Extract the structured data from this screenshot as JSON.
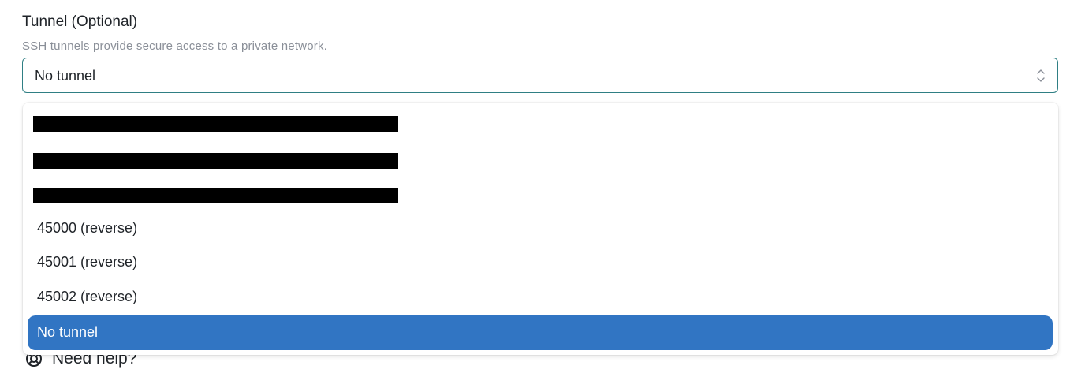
{
  "tunnel_field": {
    "label": "Tunnel (Optional)",
    "help_text": "SSH tunnels provide secure access to a private network.",
    "selected_value": "No tunnel"
  },
  "dropdown": {
    "options": [
      {
        "label": "",
        "redacted": true
      },
      {
        "label": "",
        "redacted": true
      },
      {
        "label": "",
        "redacted": true
      },
      {
        "label": "45000 (reverse)",
        "redacted": false
      },
      {
        "label": "45001 (reverse)",
        "redacted": false
      },
      {
        "label": "45002 (reverse)",
        "redacted": false
      },
      {
        "label": "No tunnel",
        "redacted": false,
        "selected": true
      }
    ]
  },
  "need_help": {
    "label": "Need help?",
    "icon": "lifebuoy-icon"
  },
  "colors": {
    "accent_border": "#2f7f84",
    "selected_option_bg": "#3175c3",
    "help_text": "#8a8f98"
  }
}
